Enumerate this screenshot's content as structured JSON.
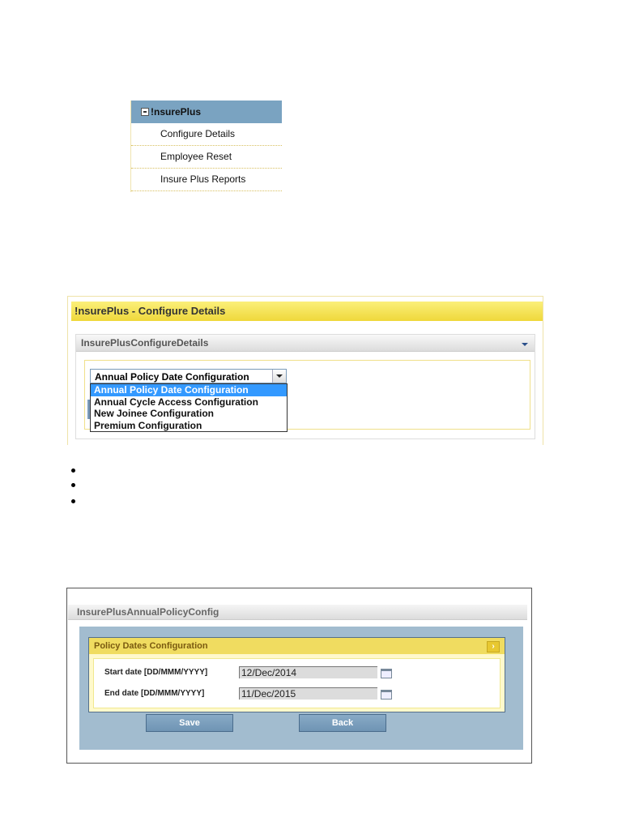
{
  "menu": {
    "title": "!nsurePlus",
    "items": [
      "Configure Details",
      "Employee Reset",
      "Insure Plus Reports"
    ]
  },
  "configure": {
    "title": "!nsurePlus - Configure Details",
    "section": "InsurePlusConfigureDetails",
    "selected": "Annual Policy Date Configuration",
    "options": [
      "Annual Policy Date Configuration",
      "Annual Cycle Access Configuration",
      "New Joinee Configuration",
      "Premium Configuration"
    ]
  },
  "annual": {
    "title": "InsurePlusAnnualPolicyConfig",
    "panel": "Policy Dates Configuration",
    "start_label": "Start date [DD/MMM/YYYY]",
    "start_value": "12/Dec/2014",
    "end_label": "End date [DD/MMM/YYYY]",
    "end_value": "11/Dec/2015",
    "save": "Save",
    "back": "Back"
  }
}
